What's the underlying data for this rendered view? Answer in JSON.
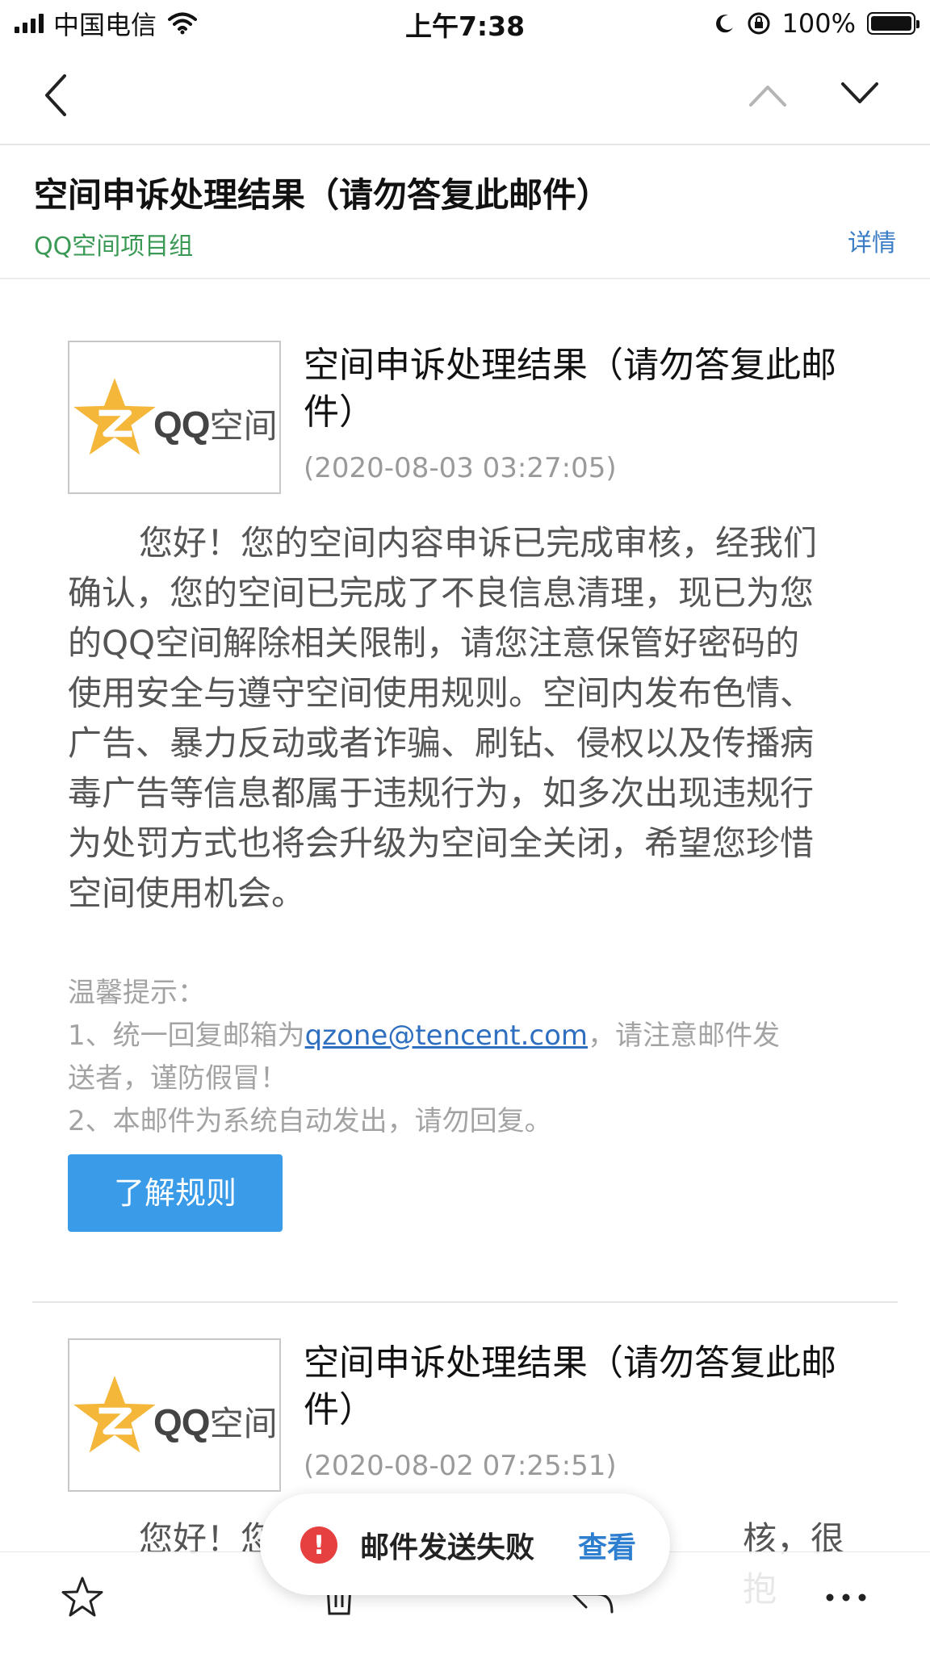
{
  "status_bar": {
    "carrier": "中国电信",
    "time": "上午7:38",
    "battery": "100%",
    "battery_level": 1.0
  },
  "nav": {
    "back_icon": "chevron-left-icon",
    "prev_icon": "chevron-up-icon",
    "next_icon": "chevron-down-icon"
  },
  "header": {
    "title": "空间申诉处理结果（请勿答复此邮件）",
    "sender": "QQ空间项目组",
    "details_label": "详情"
  },
  "messages": [
    {
      "logo_text": "QQ",
      "logo_text_cn": "空间",
      "subject_line1": "空间申诉处理结果（请勿答复此邮",
      "subject_line2": "件）",
      "date": "(2020-08-03 03:27:05)",
      "body_lines": [
        "您好！您的空间内容申诉已完成审核，经我们",
        "确认，您的空间已完成了不良信息清理，现已为您",
        "的QQ空间解除相关限制，请您注意保管好密码的",
        "使用安全与遵守空间使用规则。空间内发布色情、",
        "广告、暴力反动或者诈骗、刷钻、侵权以及传播病",
        "毒广告等信息都属于违规行为，如多次出现违规行",
        "为处罚方式也将会升级为空间全关闭，希望您珍惜",
        "空间使用机会。"
      ],
      "tips_title": "温馨提示：",
      "tip1_prefix": "1、统一回复邮箱为",
      "tip1_email": "qzone@tencent.com",
      "tip1_suffix": "，请注意邮件发",
      "tip1_line2": "送者，谨防假冒！",
      "tip2": "2、本邮件为系统自动发出，请勿回复。",
      "button_label": "了解规则"
    },
    {
      "logo_text": "QQ",
      "logo_text_cn": "空间",
      "subject_line1": "空间申诉处理结果（请勿答复此邮",
      "subject_line2": "件）",
      "date": "(2020-08-02 07:25:51)",
      "body_start": "您好！您",
      "body_partial_right": "核，很抱"
    }
  ],
  "toast": {
    "message": "邮件发送失败",
    "action": "查看",
    "icon": "alert-icon",
    "color": "#e64040"
  },
  "toolbar": {
    "icons": [
      "star-icon",
      "trash-icon",
      "reply-icon",
      "more-icon"
    ]
  },
  "colors": {
    "sender_green": "#3a9a55",
    "link_blue": "#3b7dc4",
    "button_blue": "#3a9be8"
  }
}
